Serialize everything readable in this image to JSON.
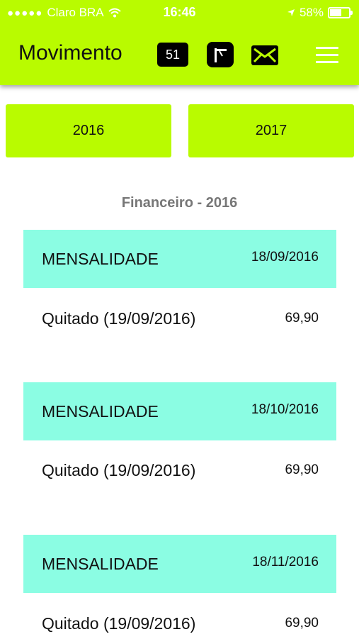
{
  "status_bar": {
    "carrier": "Claro BRA",
    "time": "16:46",
    "battery": "58%",
    "battery_level": 0.58,
    "icons": [
      "signal-dots-icon",
      "wifi-icon",
      "location-arrow-icon",
      "battery-icon"
    ]
  },
  "header": {
    "title": "Movimento",
    "badge_count": "51",
    "icons": [
      "gate-icon",
      "mail-icon",
      "menu-icon"
    ]
  },
  "years": [
    "2016",
    "2017"
  ],
  "section_title": "Financeiro - 2016",
  "entries": [
    {
      "type": "MENSALIDADE",
      "date": "18/09/2016",
      "status": "Quitado (19/09/2016)",
      "amount": "69,90"
    },
    {
      "type": "MENSALIDADE",
      "date": "18/10/2016",
      "status": "Quitado (19/09/2016)",
      "amount": "69,90"
    },
    {
      "type": "MENSALIDADE",
      "date": "18/11/2016",
      "status": "Quitado (19/09/2016)",
      "amount": "69,90"
    }
  ],
  "colors": {
    "primary": "#b9fb00",
    "card_header": "#8bfde3",
    "section_title": "#777777"
  }
}
